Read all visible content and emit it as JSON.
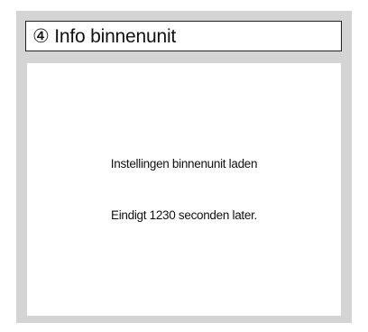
{
  "dialog": {
    "title": "④ Info binnenunit",
    "message": "Instellingen binnenunit laden",
    "countdown": "Eindigt 1230 seconden later."
  }
}
